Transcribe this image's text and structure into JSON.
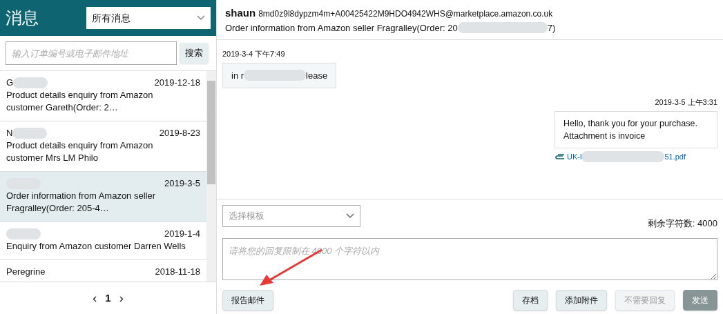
{
  "sidebar": {
    "title": "消息",
    "filter": "所有消息",
    "search": {
      "placeholder": "输入订单编号或电子邮件地址",
      "button": "搜索"
    },
    "items": [
      {
        "name": "G",
        "redacted": true,
        "date": "2019-12-18",
        "subject": "Product details enquiry from Amazon customer Gareth(Order: 2…",
        "selected": false
      },
      {
        "name": "N",
        "redacted": true,
        "date": "2019-8-23",
        "subject": "Product details enquiry from Amazon customer Mrs LM Philo",
        "selected": false
      },
      {
        "redacted": true,
        "date": "2019-3-5",
        "subject": "Order information from Amazon seller Fragralley(Order: 205-4…",
        "selected": true
      },
      {
        "redacted": true,
        "date": "2019-1-4",
        "subject": "Enquiry from Amazon customer Darren Wells",
        "selected": false
      },
      {
        "name": "Peregrine",
        "redacted": false,
        "date": "2018-11-18",
        "selected": false
      }
    ],
    "pagination": {
      "prev": "‹",
      "page": "1",
      "next": "›"
    }
  },
  "conversation": {
    "sender": "shaun",
    "address": "8md0z9l8dypzm4m+A00425422M9HDO4942WHS@marketplace.amazon.co.uk",
    "subject": [
      "Order information from Amazon seller Fragralley(Order: 20",
      "7)"
    ],
    "messages": [
      {
        "kind": "received",
        "time": "2019-3-4 下午7:49",
        "body": [
          "in r",
          "lease"
        ]
      },
      {
        "kind": "sent",
        "time": "2019-3-5 上午3:31",
        "body": [
          "Hello, thank you for your purchase. Attachment is invoice"
        ],
        "attachment": [
          "UK-l",
          "51.pdf"
        ]
      }
    ]
  },
  "reply": {
    "template": "选择模板",
    "remaining": "剩余字符数: 4000",
    "placeholder": "请将您的回复限制在 4000 个字符以内",
    "buttons": [
      {
        "label": "报告邮件",
        "kind": "normal"
      },
      {
        "label": "存档",
        "kind": "normal"
      },
      {
        "label": "添加附件",
        "kind": "normal"
      },
      {
        "label": "不需要回复",
        "kind": "disabled"
      },
      {
        "label": "发送",
        "kind": "primary"
      }
    ]
  }
}
